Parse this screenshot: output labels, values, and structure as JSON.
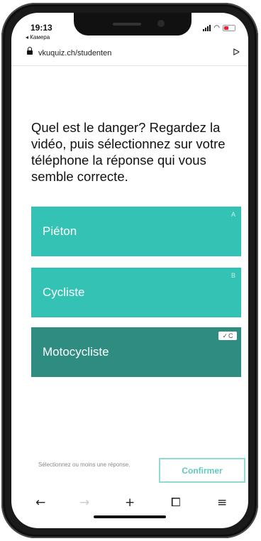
{
  "status": {
    "time": "19:13",
    "back_app": "◂ Камера"
  },
  "browser": {
    "url": "vkuquiz.ch/studenten"
  },
  "question": "Quel est le danger? Regardez la vidéo, puis sélectionnez sur votre téléphone la réponse qui vous semble correcte.",
  "answers": [
    {
      "label": "Piéton",
      "letter": "A",
      "selected": false
    },
    {
      "label": "Cycliste",
      "letter": "B",
      "selected": false
    },
    {
      "label": "Motocycliste",
      "letter": "C",
      "selected": true
    }
  ],
  "footer": {
    "hint": "Sélectionnez ou moins une réponse.",
    "confirm_label": "Confirmer"
  },
  "nav": {
    "back": "←",
    "forward": "→",
    "new_tab": "+",
    "tabs": "⧠",
    "menu": "≡"
  },
  "colors": {
    "answer_default": "#33c2b3",
    "answer_selected": "#2e8c80",
    "confirm_border": "#8fdcd4"
  },
  "icons": [
    "lock-icon",
    "share-icon",
    "signal-icon",
    "wifi-icon",
    "battery-icon",
    "check-icon"
  ]
}
